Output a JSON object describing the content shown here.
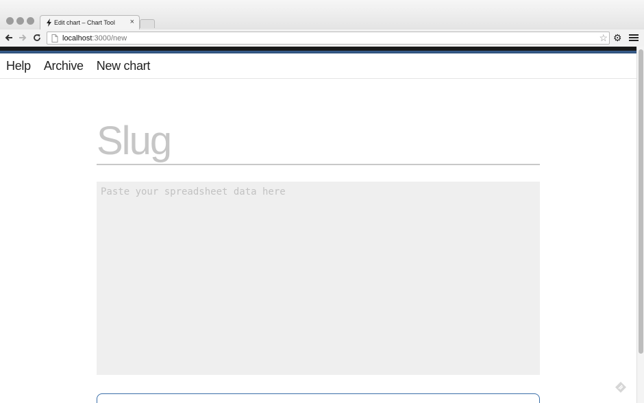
{
  "browser": {
    "tab_title": "Edit chart – Chart Tool",
    "tab_close": "×",
    "url_host": "localhost",
    "url_path": ":3000/new"
  },
  "nav": {
    "items": [
      {
        "label": "Help"
      },
      {
        "label": "Archive"
      },
      {
        "label": "New chart"
      }
    ]
  },
  "form": {
    "slug_placeholder": "Slug",
    "slug_value": "",
    "data_placeholder": "Paste your spreadsheet data here",
    "data_value": ""
  },
  "colors": {
    "accent_bar": "#2d4f7a",
    "top_bar": "#1a1a1a",
    "data_bg": "#efefef",
    "next_border": "#3a6ea8"
  },
  "icons": [
    "back-icon",
    "forward-icon",
    "reload-icon",
    "page-icon",
    "bookmark-star-icon",
    "settings-gear-icon",
    "menu-icon",
    "favicon-bolt-icon",
    "feedback-icon"
  ]
}
